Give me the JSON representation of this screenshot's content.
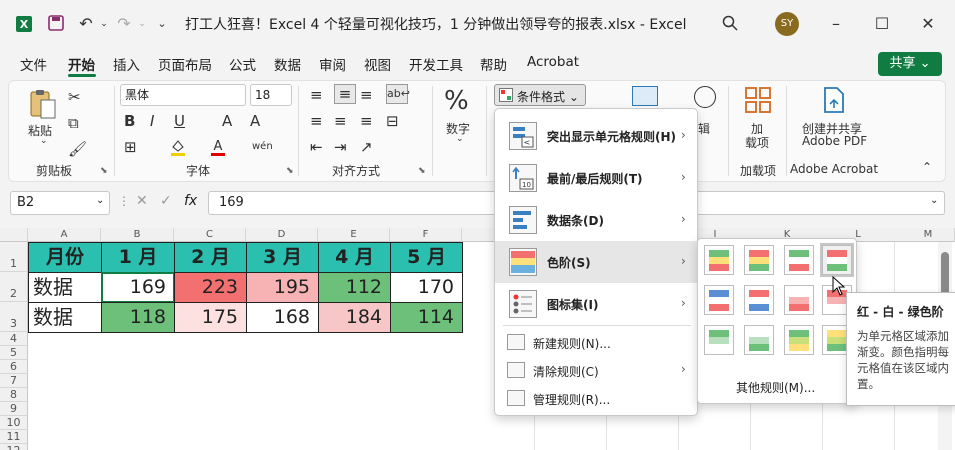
{
  "window": {
    "title": "打工人狂喜！Excel 4 个轻量可视化技巧，1 分钟做出领导夸的报表.xlsx  -  Excel",
    "avatar_initials": "SY",
    "accent_color": "#107c41"
  },
  "menu": {
    "tabs": [
      "文件",
      "开始",
      "插入",
      "页面布局",
      "公式",
      "数据",
      "审阅",
      "视图",
      "开发工具",
      "帮助",
      "Acrobat"
    ],
    "active_tab": "开始",
    "share_label": "共享 ⌄"
  },
  "ribbon": {
    "clipboard": {
      "paste": "粘贴",
      "group": "剪贴板"
    },
    "font": {
      "name": "黑体",
      "size": "18",
      "group": "字体"
    },
    "align": {
      "group": "对齐方式"
    },
    "number": {
      "label": "数字"
    },
    "cond_format": {
      "label": "条件格式 ⌄"
    },
    "edit": {
      "label": "辑"
    },
    "addins": {
      "label_1": "加",
      "label_2": "载项",
      "group": "加载项"
    },
    "acrobat": {
      "label_1": "创建并共享",
      "label_2": "Adobe PDF",
      "group": "Adobe Acrobat"
    }
  },
  "formula_bar": {
    "name_box": "B2",
    "fx": "fx",
    "value": "169"
  },
  "sheet": {
    "columns": [
      "A",
      "B",
      "C",
      "D",
      "E",
      "F",
      "I",
      "K",
      "L",
      "M"
    ],
    "rows": [
      "1",
      "2",
      "3",
      "4",
      "5",
      "6",
      "7",
      "8",
      "9",
      "10",
      "11",
      "12"
    ],
    "header_row": [
      "月份",
      "1 月",
      "2 月",
      "3 月",
      "4 月",
      "5 月"
    ],
    "row2": {
      "label": "数据",
      "values": [
        "169",
        "223",
        "195",
        "112",
        "170"
      ]
    },
    "row3": {
      "label": "数据",
      "values": [
        "118",
        "175",
        "168",
        "184",
        "114"
      ]
    },
    "colors": {
      "header_teal": "#2bbfb0",
      "red_strong": "#f27070",
      "red_mid": "#f7b3b3",
      "red_light": "#fde0e0",
      "green": "#6cc07a",
      "neutral": "#ffffff"
    }
  },
  "cf_menu": {
    "items": [
      {
        "label": "突出显示单元格规则(H)",
        "has_submenu": true
      },
      {
        "label": "最前/最后规则(T)",
        "has_submenu": true
      },
      {
        "label": "数据条(D)",
        "has_submenu": true
      },
      {
        "label": "色阶(S)",
        "has_submenu": true,
        "highlighted": true
      },
      {
        "label": "图标集(I)",
        "has_submenu": true
      },
      {
        "label": "新建规则(N)...",
        "has_submenu": false
      },
      {
        "label": "清除规则(C)",
        "has_submenu": true
      },
      {
        "label": "管理规则(R)...",
        "has_submenu": false
      }
    ]
  },
  "color_scale_submenu": {
    "other_rules": "其他规则(M)...",
    "selected_index": 3
  },
  "tooltip": {
    "title": "红 - 白 - 绿色阶",
    "lines": [
      "为单元格区域添加",
      "渐变。颜色指明每",
      "元格值在该区域内",
      "置。"
    ]
  }
}
